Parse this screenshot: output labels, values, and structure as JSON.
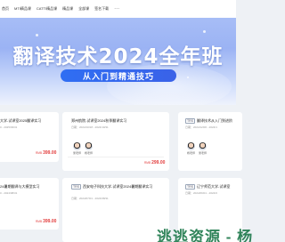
{
  "nav": {
    "items": [
      "首页",
      "MTI精品课",
      "CATTI精品课",
      "精品课",
      "全部课",
      "签名下载"
    ],
    "more": "···"
  },
  "banner": {
    "title": "翻译技术2024全年班",
    "subtitle": "从入门到精通技巧"
  },
  "cards": [
    {
      "title": "大学-试译室2025翻译实习",
      "date": "",
      "teachers": [],
      "price_unit": "",
      "price": "",
      "price_label": "399.00"
    },
    {
      "tag": "",
      "title": "郑州航院-试译室2024秋季翻译实习",
      "date": "日期：2024/10/18 - 2024/10/31",
      "teachers": [
        "吴老师",
        "杨老师"
      ],
      "price_unit": "RMB",
      "price_label": "299.00"
    },
    {
      "title": "翻译技术从入门到进阶",
      "date": "日期：2024/12/06 - 2024/1",
      "teachers": [
        "杨老师",
        "吴老师"
      ],
      "price_unit": "",
      "price_label": ""
    },
    {
      "title": "24暑期翻译与大模型实习",
      "date": "",
      "price_unit": "RMB",
      "price_label": "399.00"
    },
    {
      "tag": "",
      "title": "西安电子科技大学-试译室2024暑期翻译实习",
      "date": "",
      "price_label": ""
    },
    {
      "title": "辽宁师范大学-试译室",
      "date": "",
      "price_label": ""
    }
  ],
  "left_top_price_unit": "RMB",
  "left_top_price": "399.00",
  "left_top_date": "0 - 2025/03/31",
  "left_bottom_date": "0 - 2024/08/31",
  "mid_bottom_date": "日期：2024/07/01 - 2024/08/31",
  "right_bottom_date": "日期：2024/06/01 - 2024/0",
  "right_top_date": "日期：2024/12/06 - 2024/1",
  "mid_top_price_unit": "RMB",
  "mid_top_price": "299.00",
  "left_bottom_price_unit": "RMB",
  "left_bottom_price": "399.00",
  "watermark": "逃逃资源 - 杨",
  "colors": {
    "price": "#e23c3c",
    "pill": "#2f6ef3",
    "banner_top": "#a7bdf6",
    "watermark": "#1f7a4d"
  }
}
